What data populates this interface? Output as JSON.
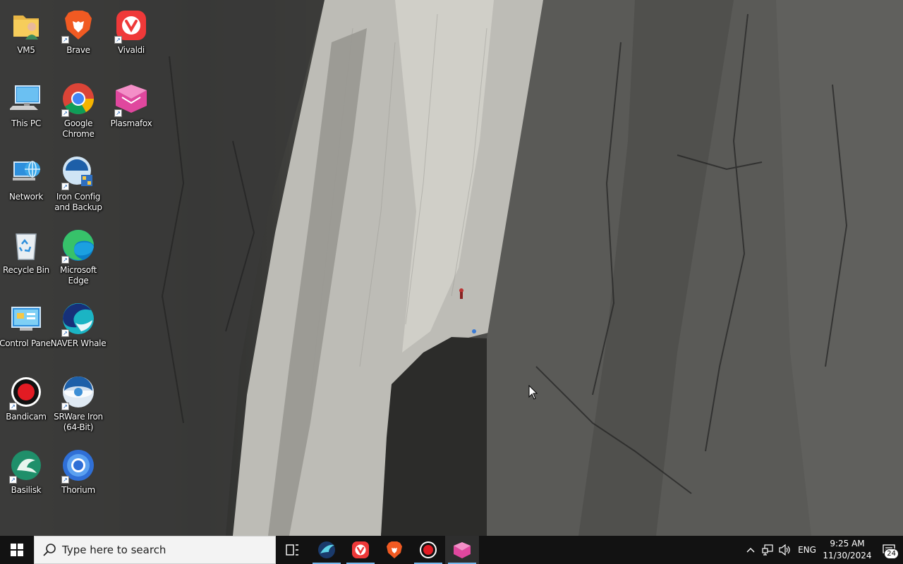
{
  "desktop": {
    "icons": [
      {
        "label": "VM5"
      },
      {
        "label": "Brave"
      },
      {
        "label": "Vivaldi"
      },
      {
        "label": "This PC"
      },
      {
        "label": "Google Chrome"
      },
      {
        "label": "Plasmafox"
      },
      {
        "label": "Network"
      },
      {
        "label": "Iron Config and Backup"
      },
      {
        "label": "Recycle Bin"
      },
      {
        "label": "Microsoft Edge"
      },
      {
        "label": "Control Panel"
      },
      {
        "label": "NAVER Whale"
      },
      {
        "label": "Bandicam"
      },
      {
        "label": "SRWare Iron (64-Bit)"
      },
      {
        "label": "Basilisk"
      },
      {
        "label": "Thorium"
      }
    ]
  },
  "taskbar": {
    "search_placeholder": "Type here to search",
    "pinned": [
      "task-view",
      "swift-browser",
      "vivaldi",
      "brave",
      "bandicam",
      "plasmafox"
    ],
    "tray": {
      "language": "ENG",
      "time": "9:25 AM",
      "date": "11/30/2024",
      "notification_count": "24"
    }
  },
  "colors": {
    "taskbar_bg": "#121212",
    "running_indicator": "#76b9ed",
    "search_bg": "#f3f3f3"
  }
}
